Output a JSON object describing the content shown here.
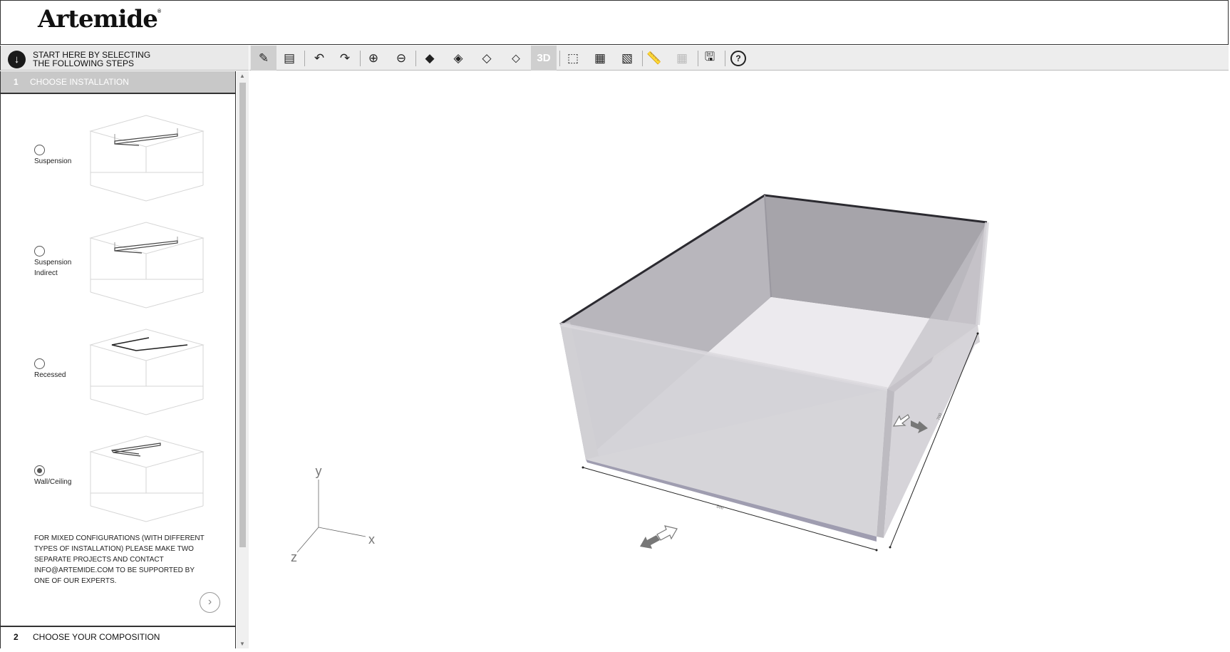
{
  "header": {
    "logo_text": "Artemide",
    "logo_mark": "®"
  },
  "start": {
    "icon": "arrow-down-circle-icon",
    "line1": "START HERE BY SELECTING",
    "line2": "THE FOLLOWING STEPS"
  },
  "toolbar": {
    "tools": [
      {
        "name": "draw-pencil",
        "icon": "✎"
      },
      {
        "name": "notes-list",
        "icon": "▤"
      },
      {
        "name": "undo",
        "icon": "↶"
      },
      {
        "name": "redo",
        "icon": "↷"
      },
      {
        "name": "zoom-in",
        "icon": "⊕"
      },
      {
        "name": "zoom-out",
        "icon": "⊖"
      },
      {
        "name": "view-top",
        "icon": "◆"
      },
      {
        "name": "view-side",
        "icon": "◈"
      },
      {
        "name": "view-wire",
        "icon": "◇"
      },
      {
        "name": "view-iso",
        "icon": "⬦"
      },
      {
        "name": "view-3d",
        "label": "3D"
      },
      {
        "name": "select-area",
        "icon": "⬚"
      },
      {
        "name": "select-object",
        "icon": "▦"
      },
      {
        "name": "select-multi",
        "icon": "▧"
      },
      {
        "name": "measure-ruler",
        "icon": "📏"
      },
      {
        "name": "grid",
        "icon": "▦"
      },
      {
        "name": "save",
        "icon": "💾"
      },
      {
        "name": "help",
        "icon": "?"
      }
    ]
  },
  "steps": {
    "step1": {
      "number": "1",
      "label": "CHOOSE INSTALLATION"
    },
    "options": [
      {
        "label": "Suspension",
        "checked": false
      },
      {
        "label": "Suspension Indirect",
        "checked": false
      },
      {
        "label": "Recessed",
        "checked": false
      },
      {
        "label": "Wall/Ceiling",
        "checked": true
      }
    ],
    "note": "FOR MIXED CONFIGURATIONS (WITH DIFFERENT TYPES OF INSTALLATION) PLEASE MAKE TWO SEPARATE PROJECTS AND CONTACT INFO@ARTEMIDE.COM TO BE SUPPORTED BY ONE OF OUR EXPERTS.",
    "next_icon": "chevron-right-icon",
    "step2": {
      "number": "2",
      "label": "CHOOSE YOUR COMPOSITION"
    }
  },
  "viewport": {
    "axis_labels": {
      "x": "x",
      "y": "y",
      "z": "z"
    },
    "dim_width": "500",
    "dim_depth": "700"
  }
}
